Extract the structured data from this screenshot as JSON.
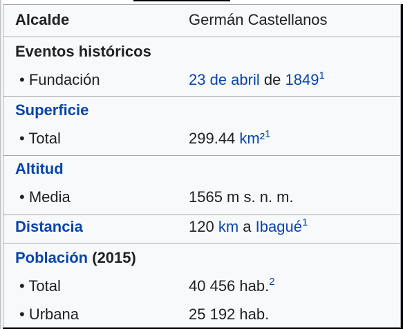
{
  "infobox": {
    "alcalde": {
      "label": "Alcalde",
      "value": "Germán Castellanos"
    },
    "eventos": {
      "header": "Eventos históricos",
      "fundacion_label": "• Fundación",
      "fundacion_date_link": "23 de abril",
      "fundacion_connector": "de",
      "fundacion_year_link": "1849",
      "fundacion_ref": "1"
    },
    "superficie": {
      "header": "Superficie",
      "total_label": "• Total",
      "total_value": "299.44",
      "total_unit_link": "km²",
      "total_ref": "1"
    },
    "altitud": {
      "header": "Altitud",
      "media_label": "• Media",
      "media_value": "1565 m s. n. m."
    },
    "distancia": {
      "header": "Distancia",
      "value_number": "120",
      "value_unit_link": "km",
      "value_connector": "a",
      "value_place_link": "Ibagué",
      "value_ref": "1"
    },
    "poblacion": {
      "header_link": "Población",
      "header_year": "(2015)",
      "total_label": "• Total",
      "total_value": "40 456 hab.",
      "total_ref": "2",
      "urbana_label": "• Urbana",
      "urbana_value": "25 192 hab."
    }
  },
  "colors": {
    "link": "#0645ad",
    "text": "#202122",
    "box_background": "#f8f9fa",
    "border": "#a2a9b1"
  }
}
